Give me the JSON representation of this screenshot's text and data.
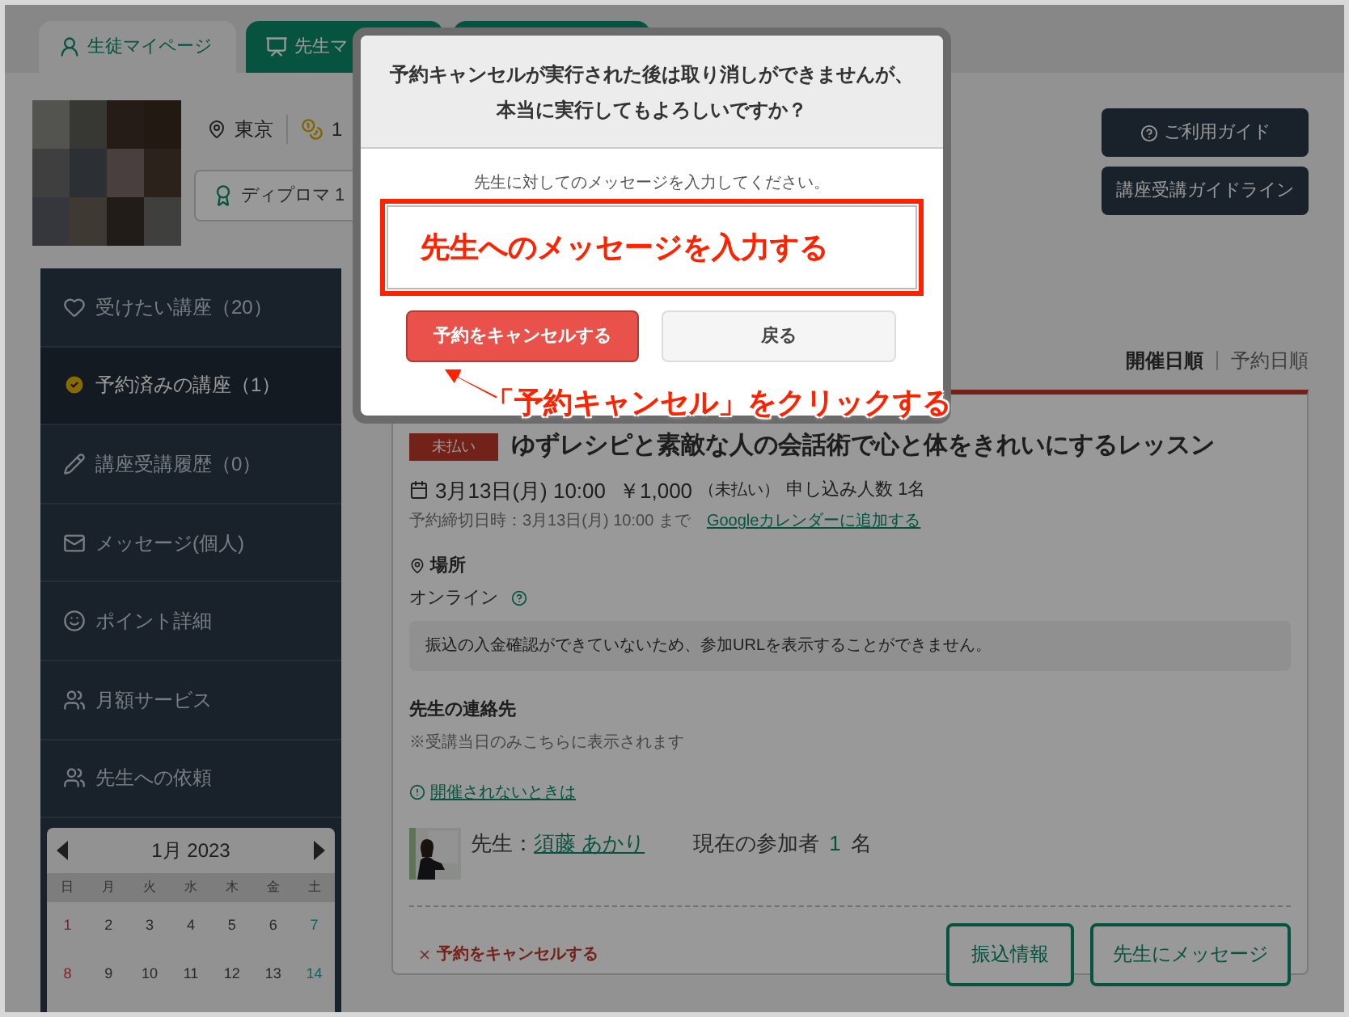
{
  "tabs": [
    {
      "label": "生徒マイページ",
      "selected": true
    },
    {
      "label": "先生マ",
      "selected": false
    },
    {
      "selected": false
    }
  ],
  "profile": {
    "location": "東京",
    "points": "1",
    "diploma": "ディプロマ 1"
  },
  "guide_buttons": [
    {
      "label": "ご利用ガイド",
      "kind": "help"
    },
    {
      "label": "講座受講ガイドライン",
      "kind": "plain"
    }
  ],
  "sidebar": {
    "items": [
      {
        "label": "受けたい講座（20）",
        "kind": "heart",
        "selected": false
      },
      {
        "label": "予約済みの講座（1）",
        "kind": "check",
        "selected": true
      },
      {
        "label": "講座受講履歴（0）",
        "kind": "pencil",
        "selected": false
      },
      {
        "label": "メッセージ(個人)",
        "kind": "mail",
        "selected": false
      },
      {
        "label": "ポイント詳細",
        "kind": "points",
        "selected": false
      },
      {
        "label": "月額サービス",
        "kind": "people",
        "selected": false
      },
      {
        "label": "先生への依頼",
        "kind": "people",
        "selected": false
      }
    ]
  },
  "calendar": {
    "month": "1月 2023",
    "weekdays": [
      "日",
      "月",
      "火",
      "水",
      "木",
      "金",
      "土"
    ],
    "weeks": [
      [
        {
          "day": "1",
          "kind": "sun"
        },
        {
          "day": "2",
          "kind": "day"
        },
        {
          "day": "3",
          "kind": "day"
        },
        {
          "day": "4",
          "kind": "day"
        },
        {
          "day": "5",
          "kind": "day"
        },
        {
          "day": "6",
          "kind": "day"
        },
        {
          "day": "7",
          "kind": "sat"
        }
      ],
      [
        {
          "day": "8",
          "kind": "sun"
        },
        {
          "day": "9",
          "kind": "day"
        },
        {
          "day": "10",
          "kind": "day"
        },
        {
          "day": "11",
          "kind": "day"
        },
        {
          "day": "12",
          "kind": "day"
        },
        {
          "day": "13",
          "kind": "day"
        },
        {
          "day": "14",
          "kind": "sat"
        }
      ]
    ]
  },
  "sort": [
    {
      "label": "開催日順",
      "selected": true
    },
    {
      "label": "予約日順",
      "selected": false
    }
  ],
  "card": {
    "status": "未払い",
    "title": "ゆずレシピと素敵な人の会話術で心と体をきれいにするレッスン",
    "date": "3月13日(月) 10:00",
    "price": "￥1,000",
    "payment_note": "（未払い）",
    "applicants": "申し込み人数 1名",
    "deadline": "予約締切日時：3月13日(月) 10:00 まで",
    "calendar_link": "Googleカレンダーに追加する",
    "place_heading": "場所",
    "place": "オンライン",
    "notice": "振込の入金確認ができていないため、参加URLを表示することができません。",
    "contact_heading": "先生の連絡先",
    "contact_note": "※受講当日のみこちらに表示されます",
    "help_link": "開催されないときは",
    "teacher_label": "先生：",
    "teacher_name": "須藤 あかり",
    "participants_label": "現在の参加者",
    "participants_count": "1",
    "participants_unit": "名",
    "cancel_link": "予約をキャンセルする",
    "buttons": [
      "振込情報",
      "先生にメッセージ"
    ]
  },
  "modal": {
    "message": [
      "予約キャンセルが実行された後は取り消しができませんが、",
      "本当に実行してもよろしいですか？"
    ],
    "field_label": "先生に対してのメッセージを入力してください。",
    "field_annotation": "先生へのメッセージを入力する",
    "confirm": "予約をキャンセルする",
    "back": "戻る"
  },
  "annotation": {
    "callout": "「予約キャンセル」をクリックする"
  }
}
